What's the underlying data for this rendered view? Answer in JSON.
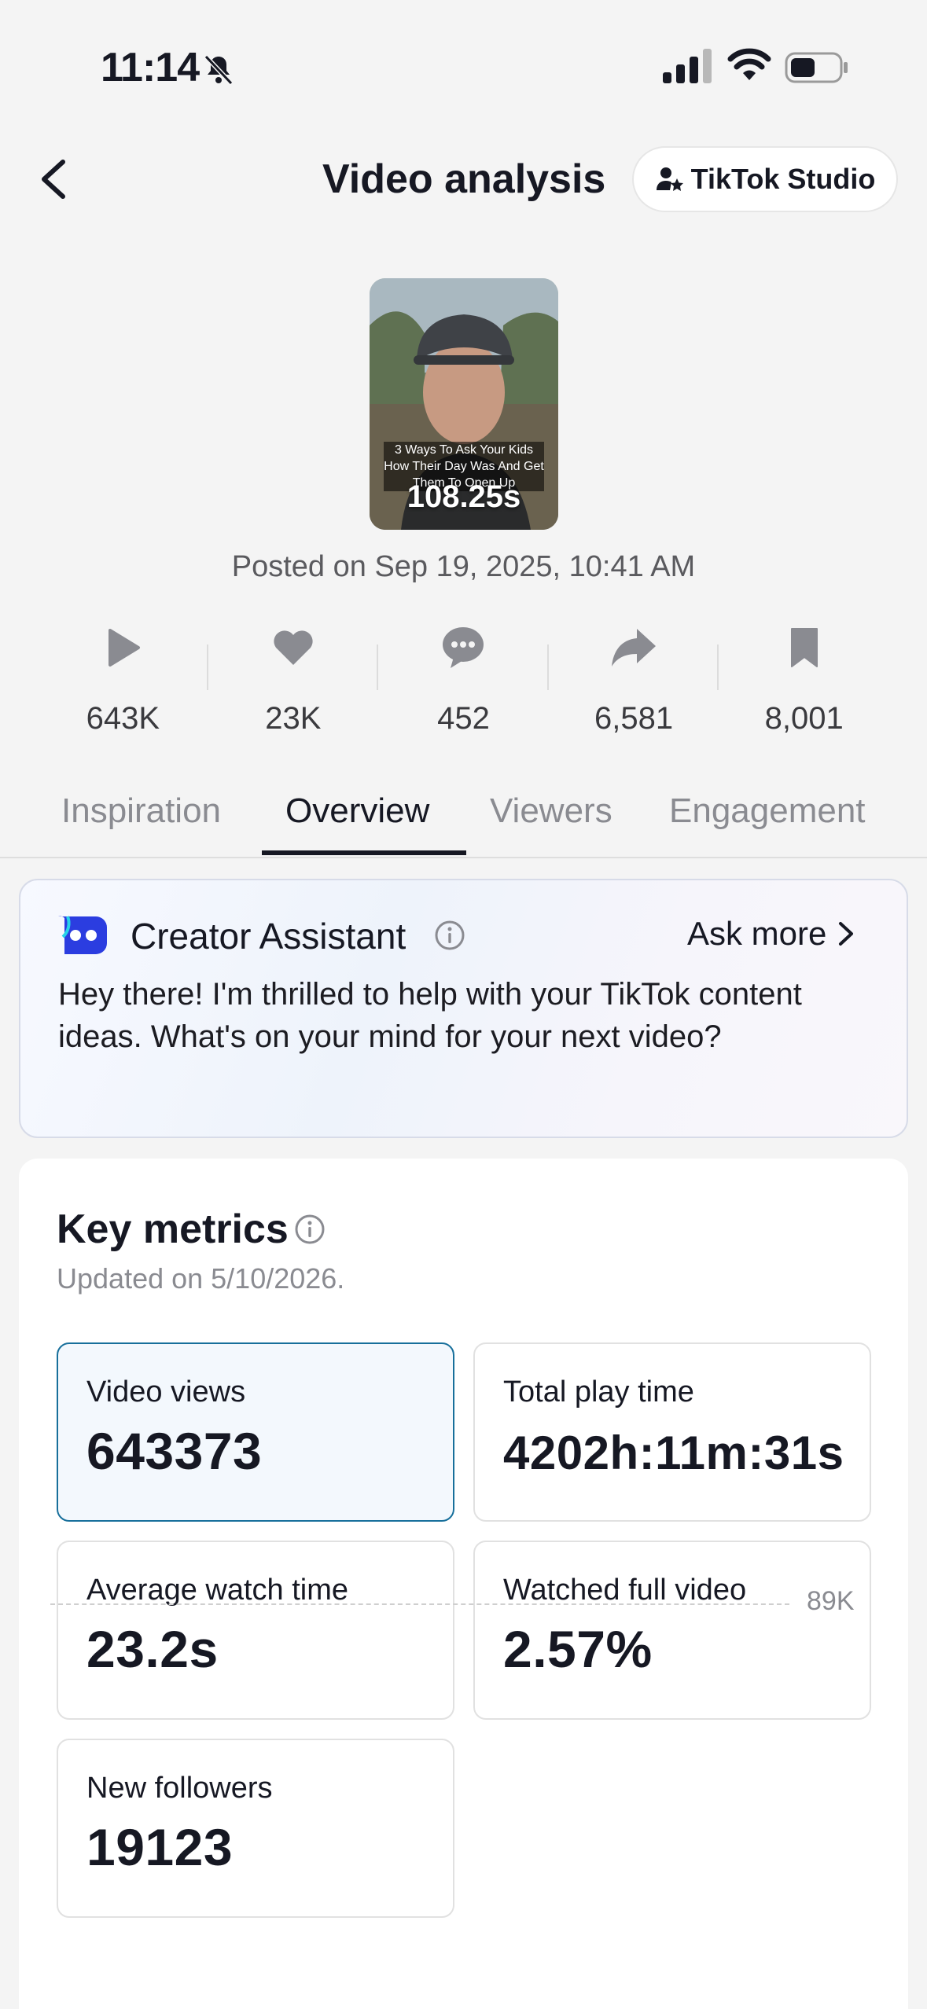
{
  "status_bar": {
    "time": "11:14"
  },
  "nav": {
    "title": "Video analysis",
    "studio_button": "TikTok Studio"
  },
  "video": {
    "overlay_text": "3 Ways To Ask Your Kids How Their Day Was And Get Them To Open Up",
    "duration": "108.25s",
    "posted": "Posted on Sep 19, 2025, 10:41 AM"
  },
  "stats": [
    {
      "icon": "play-icon",
      "value": "643K"
    },
    {
      "icon": "heart-icon",
      "value": "23K"
    },
    {
      "icon": "comment-icon",
      "value": "452"
    },
    {
      "icon": "share-icon",
      "value": "6,581"
    },
    {
      "icon": "bookmark-icon",
      "value": "8,001"
    }
  ],
  "tabs": [
    {
      "label": "Inspiration",
      "active": false
    },
    {
      "label": "Overview",
      "active": true
    },
    {
      "label": "Viewers",
      "active": false
    },
    {
      "label": "Engagement",
      "active": false
    }
  ],
  "assistant": {
    "title": "Creator Assistant",
    "ask_more": "Ask more",
    "message": "Hey there! I'm thrilled to help with your TikTok content ideas. What's on your mind for your next video?"
  },
  "key_metrics": {
    "title": "Key metrics",
    "updated": "Updated on 5/10/2026.",
    "cards": [
      {
        "label": "Video views",
        "value": "643373",
        "selected": true
      },
      {
        "label": "Total play time",
        "value": "4202h:11m:31s",
        "selected": false
      },
      {
        "label": "Average watch time",
        "value": "23.2s",
        "selected": false
      },
      {
        "label": "Watched full video",
        "value": "2.57%",
        "selected": false
      },
      {
        "label": "New followers",
        "value": "19123",
        "selected": false
      }
    ],
    "chart_top_label": "89K"
  },
  "colors": {
    "background": "#f4f4f4",
    "text_primary": "#161823",
    "text_secondary": "#8a8b91",
    "selected_border": "#176f9b",
    "selected_bg": "#f3f8fd",
    "assistant_blue": "#2b3de0"
  }
}
